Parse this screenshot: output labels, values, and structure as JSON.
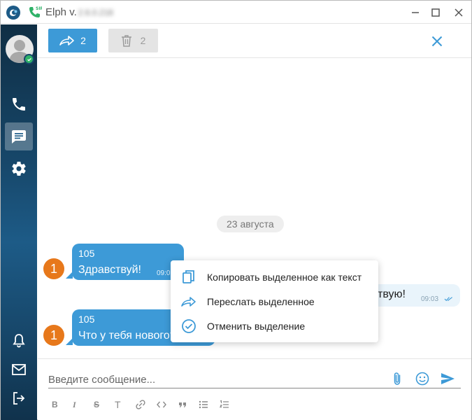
{
  "window": {
    "title": "Elph v.",
    "version": "2.6.0.218"
  },
  "colors": {
    "accent": "#3d9ad7",
    "badge": "#e7781b",
    "online": "#2fb268",
    "sidebar": "#17476a"
  },
  "selection_toolbar": {
    "forward_count": "2",
    "delete_count": "2"
  },
  "chat": {
    "date_separator": "23 августа",
    "messages": [
      {
        "count": "1",
        "sender": "105",
        "text": "Здравствуй!",
        "time": "09:0"
      },
      {
        "text": "твую!",
        "time": "09:03"
      },
      {
        "count": "1",
        "sender": "105",
        "text": "Что у тебя нового?",
        "time": ""
      }
    ]
  },
  "context_menu": {
    "items": [
      {
        "label": "Копировать выделенное как текст",
        "icon": "copy-icon"
      },
      {
        "label": "Переслать выделенное",
        "icon": "forward-icon"
      },
      {
        "label": "Отменить выделение",
        "icon": "check-circle-icon"
      }
    ]
  },
  "composer": {
    "placeholder": "Введите сообщение...",
    "format_buttons": [
      "B",
      "I",
      "S",
      "T"
    ]
  }
}
